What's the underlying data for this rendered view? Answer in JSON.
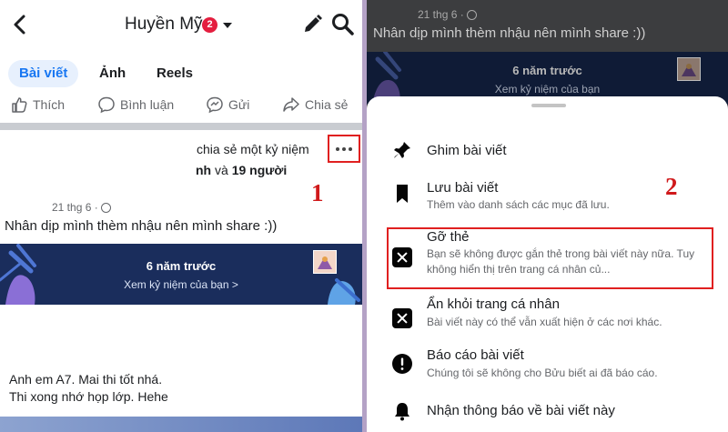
{
  "left": {
    "header": {
      "profile_name": "Huyền Mỹ",
      "notification_count": "2"
    },
    "tabs": [
      {
        "label": "Bài viết"
      },
      {
        "label": "Ảnh"
      },
      {
        "label": "Reels"
      }
    ],
    "actions": [
      {
        "label": "Thích"
      },
      {
        "label": "Bình luận"
      },
      {
        "label": "Gửi"
      },
      {
        "label": "Chia sẻ"
      }
    ],
    "post": {
      "share_text": "chia sẻ một kỷ niệm",
      "tagged_prefix": "nh",
      "tagged_middle": " và ",
      "tagged_people": "19 người",
      "date": "21 thg 6 ·",
      "body": "Nhân dịp mình thèm nhậu nên mình share :))",
      "memory_title": "6 năm trước",
      "memory_sub": "Xem kỷ niệm của bạn >",
      "caption_line1": "Anh em A7. Mai thi tốt nhá.",
      "caption_line2": "Thi xong nhớ họp lớp. Hehe"
    },
    "step_label": "1"
  },
  "right": {
    "post": {
      "date": "21 thg 6 ·",
      "body": "Nhân dịp mình thèm nhậu nên mình share :))",
      "memory_title": "6 năm trước",
      "memory_sub": "Xem kỷ niệm của bạn"
    },
    "step_label": "2",
    "sheet_options": [
      {
        "icon": "pin-icon",
        "title": "Ghim bài viết",
        "desc": ""
      },
      {
        "icon": "bookmark-icon",
        "title": "Lưu bài viết",
        "desc": "Thêm vào danh sách các mục đã lưu."
      },
      {
        "icon": "close-square-icon",
        "title": "Gỡ thẻ",
        "desc": "Bạn sẽ không được gắn thẻ trong bài viết này nữa. Tuy không hiển thị trên trang cá nhân củ..."
      },
      {
        "icon": "close-square-icon",
        "title": "Ẩn khỏi trang cá nhân",
        "desc": "Bài viết này có thể vẫn xuất hiện ở các nơi khác."
      },
      {
        "icon": "alert-circle-icon",
        "title": "Báo cáo bài viết",
        "desc": "Chúng tôi sẽ không cho Bửu biết ai đã báo cáo."
      },
      {
        "icon": "bell-icon",
        "title": "Nhận thông báo về bài viết này",
        "desc": ""
      }
    ]
  },
  "colors": {
    "accent": "#1877f2",
    "highlight": "#e02020",
    "memory_bg": "#1a2d5c"
  }
}
